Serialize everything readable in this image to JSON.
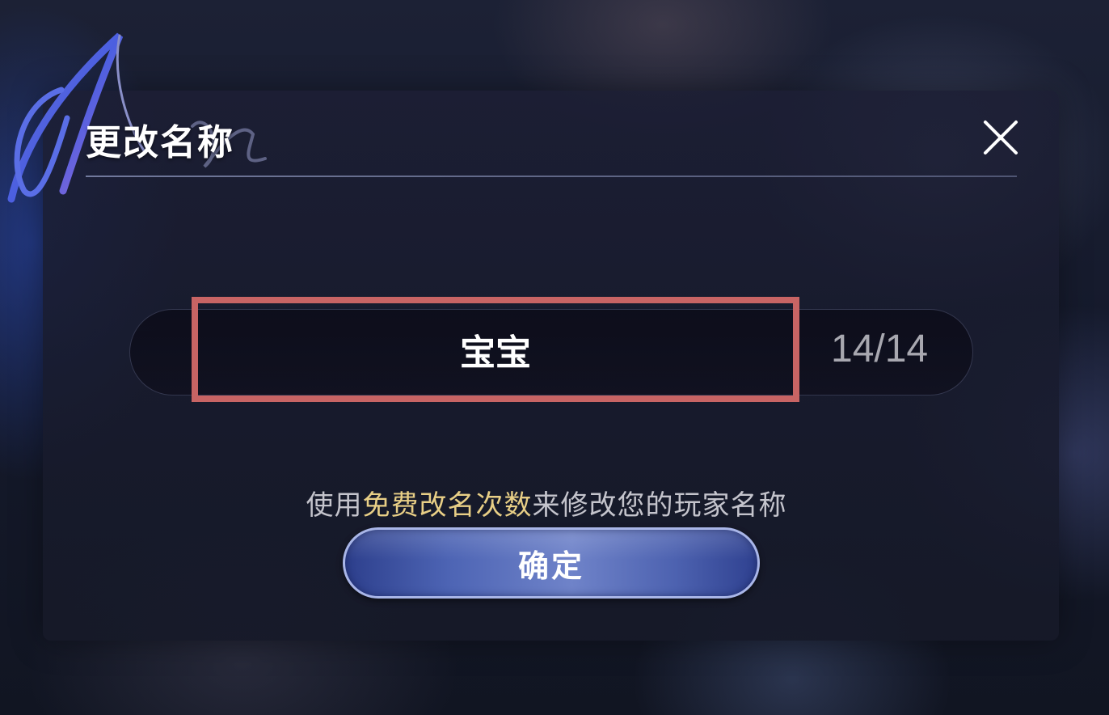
{
  "dialog": {
    "title": "更改名称",
    "close_icon": "close-icon"
  },
  "name_field": {
    "value": "宝宝",
    "char_count": "14/14"
  },
  "hint": {
    "prefix": "使用",
    "highlight": "免费改名次数",
    "suffix": "来修改您的玩家名称"
  },
  "confirm_button": {
    "label": "确定"
  },
  "colors": {
    "highlight": "#e8cf86",
    "selection_outline": "#c86464",
    "button_blue": "#4d64b4"
  }
}
